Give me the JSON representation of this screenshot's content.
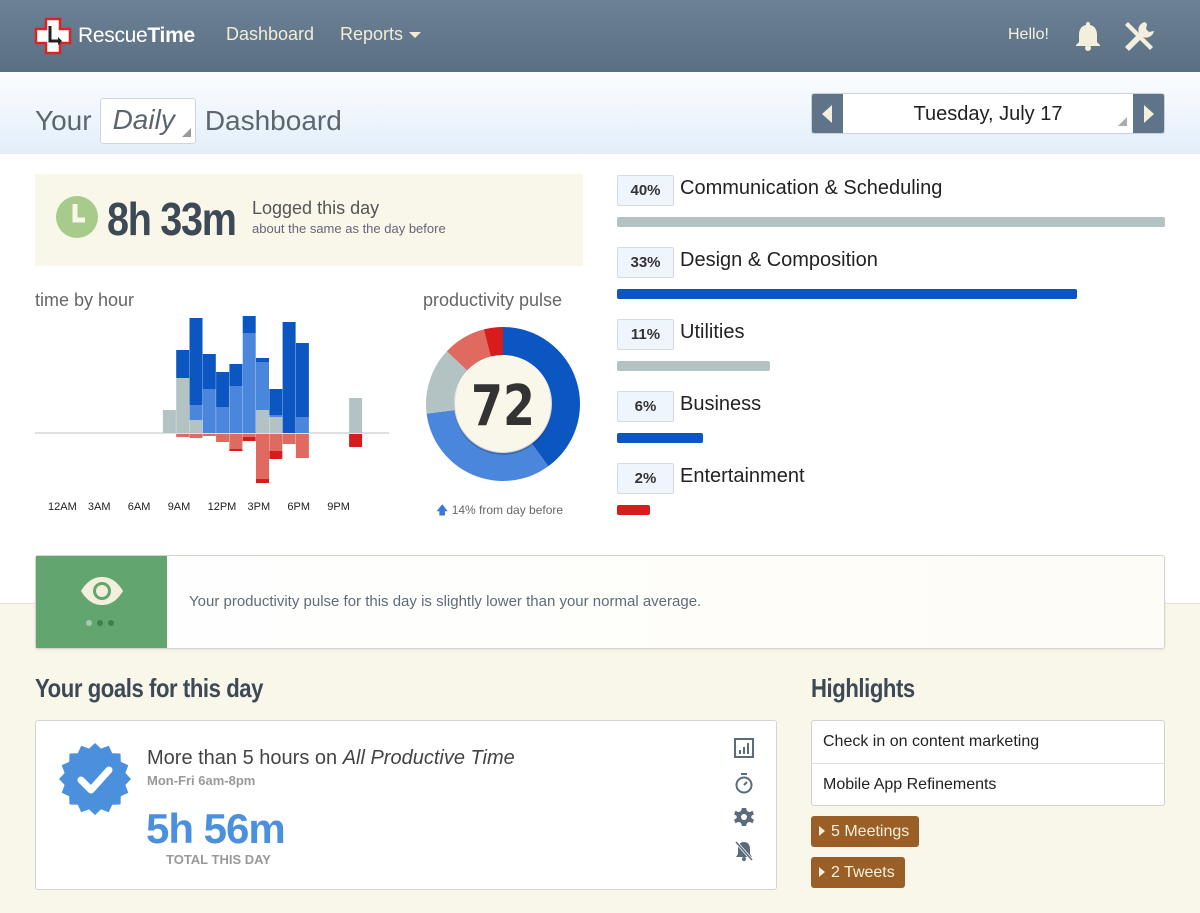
{
  "header": {
    "brand_light": "Rescue",
    "brand_bold": "Time",
    "nav": [
      {
        "label": "Dashboard"
      },
      {
        "label": "Reports"
      }
    ],
    "greeting": "Hello!",
    "icons": [
      "logo-cross-icon",
      "bell-icon",
      "tools-icon"
    ]
  },
  "subheader": {
    "title_prefix": "Your",
    "period_selected": "Daily",
    "title_suffix": "Dashboard",
    "date_label": "Tuesday, July 17"
  },
  "logged": {
    "time": "8h 33m",
    "label": "Logged this day",
    "comparison": "about the same as the day before"
  },
  "colors": {
    "very_productive": "#0c56c2",
    "productive": "#4a86dc",
    "neutral": "#b3c2c3",
    "distracting": "#e06a60",
    "very_distracting": "#d71c1c"
  },
  "chart_data": [
    {
      "type": "bar",
      "title": "time by hour",
      "stacked": true,
      "diverging": true,
      "x_ticks": [
        "12AM",
        "3AM",
        "6AM",
        "9AM",
        "12PM",
        "3PM",
        "6PM",
        "9PM"
      ],
      "hours": [
        8,
        9,
        10,
        11,
        12,
        13,
        14,
        15,
        16,
        17,
        18,
        22
      ],
      "unit": "relative minutes (approx.)",
      "series": [
        {
          "name": "neutral",
          "values": [
            23,
            55,
            13,
            0,
            0,
            0,
            0,
            23,
            16,
            0,
            0,
            35
          ]
        },
        {
          "name": "productive",
          "values": [
            0,
            0,
            15,
            44,
            26,
            47,
            100,
            48,
            2,
            0,
            16,
            0
          ]
        },
        {
          "name": "very productive",
          "values": [
            0,
            28,
            87,
            35,
            35,
            22,
            17,
            4,
            26,
            111,
            74,
            0
          ]
        },
        {
          "name": "distracting",
          "values": [
            0,
            3,
            4,
            2,
            8,
            15,
            3,
            45,
            17,
            10,
            24,
            0
          ]
        },
        {
          "name": "very distracting",
          "values": [
            0,
            0,
            0,
            0,
            0,
            2,
            4,
            4,
            8,
            0,
            0,
            13
          ]
        }
      ]
    },
    {
      "type": "pie",
      "title": "productivity pulse",
      "donut": true,
      "center_label": "72",
      "change_text": "14% from day before",
      "change_direction": "up",
      "slices": [
        {
          "name": "very productive",
          "value": 40
        },
        {
          "name": "productive",
          "value": 33
        },
        {
          "name": "neutral",
          "value": 14
        },
        {
          "name": "distracting",
          "value": 9
        },
        {
          "name": "very distracting",
          "value": 4
        }
      ]
    }
  ],
  "categories": [
    {
      "pct": "40%",
      "name": "Communication & Scheduling",
      "fraction": 1.0,
      "color": "#b3c2c3"
    },
    {
      "pct": "33%",
      "name": "Design & Composition",
      "fraction": 0.84,
      "color": "#0c56c2"
    },
    {
      "pct": "11%",
      "name": "Utilities",
      "fraction": 0.28,
      "color": "#b3c2c3"
    },
    {
      "pct": "6%",
      "name": "Business",
      "fraction": 0.157,
      "color": "#0c56c2"
    },
    {
      "pct": "2%",
      "name": "Entertainment",
      "fraction": 0.06,
      "color": "#d71c1c"
    }
  ],
  "insight": {
    "text": "Your productivity pulse for this day is slightly lower than your normal average.",
    "icon": "eye-icon"
  },
  "goals": {
    "title": "Your goals for this day",
    "items": [
      {
        "description_prefix": "More than 5 hours on ",
        "description_target": "All Productive Time",
        "schedule": "Mon-Fri 6am-8pm",
        "total": "5h 56m",
        "total_label": "TOTAL THIS DAY",
        "actions": [
          "report-chart-icon",
          "stopwatch-icon",
          "settings-gear-icon",
          "mute-bell-icon"
        ]
      }
    ]
  },
  "highlights": {
    "title": "Highlights",
    "items": [
      "Check in on content marketing",
      "Mobile App Refinements"
    ],
    "pills": [
      "5 Meetings",
      "2 Tweets"
    ]
  }
}
